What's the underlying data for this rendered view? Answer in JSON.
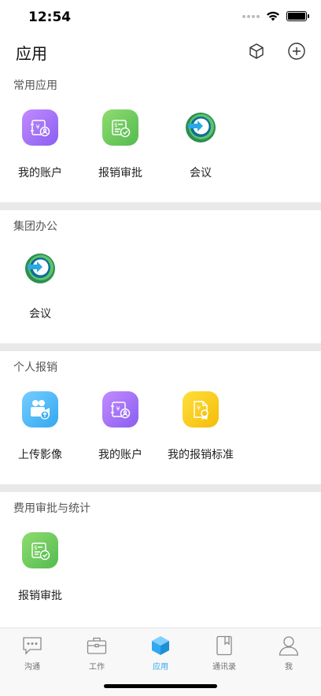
{
  "status": {
    "time": "12:54"
  },
  "nav": {
    "title": "应用",
    "icons": [
      "cube-icon",
      "plus-circle-icon"
    ]
  },
  "sections": [
    {
      "title": "常用应用",
      "apps": [
        "我的账户",
        "报销审批",
        "会议"
      ]
    },
    {
      "title": "集团办公",
      "apps": [
        "会议"
      ]
    },
    {
      "title": "个人报销",
      "apps": [
        "上传影像",
        "我的账户",
        "我的报销标准"
      ]
    },
    {
      "title": "费用审批与统计",
      "apps": [
        "报销审批"
      ]
    }
  ],
  "tabs": [
    {
      "label": "沟通",
      "icon": "chat-icon",
      "active": false
    },
    {
      "label": "工作",
      "icon": "briefcase-icon",
      "active": false
    },
    {
      "label": "应用",
      "icon": "cube-icon",
      "active": true
    },
    {
      "label": "通讯录",
      "icon": "contacts-icon",
      "active": false
    },
    {
      "label": "我",
      "icon": "person-icon",
      "active": false
    }
  ],
  "colors": {
    "accent": "#32a8f0",
    "divider": "#e9e9e9"
  }
}
